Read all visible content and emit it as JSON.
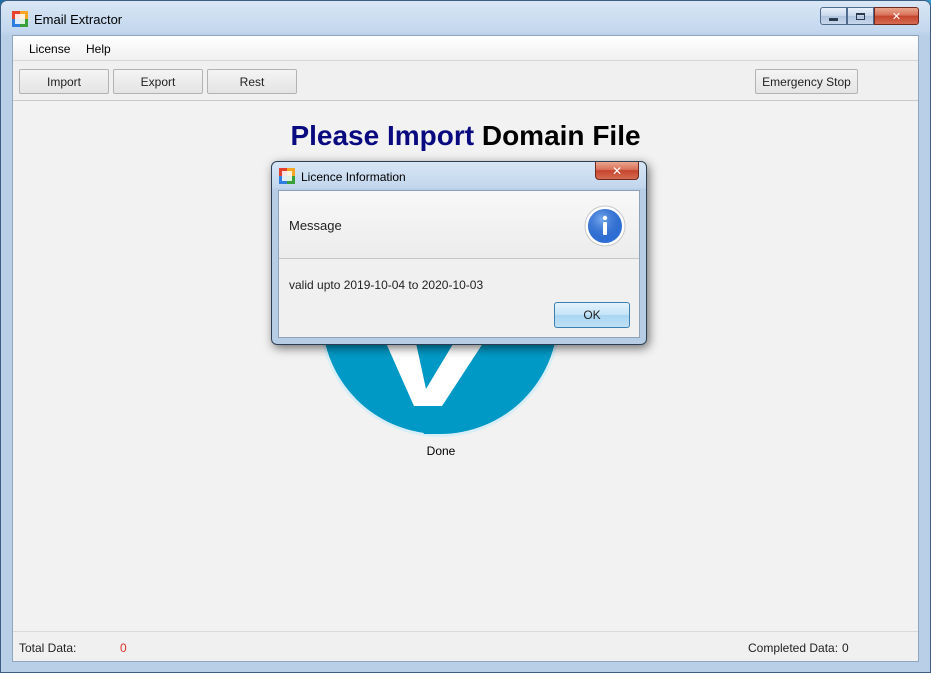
{
  "window": {
    "title": "Email Extractor",
    "controls": {
      "minimize": "",
      "maximize": "",
      "close": "✕"
    }
  },
  "menu": {
    "items": [
      "License",
      "Help"
    ]
  },
  "toolbar": {
    "import_label": "Import",
    "export_label": "Export",
    "rest_label": "Rest",
    "emergency_stop_label": "Emergency Stop"
  },
  "main": {
    "headline_part1": "Please Import",
    "headline_part2": "Domain File",
    "status_label": "Done",
    "status_color": "#0099c6"
  },
  "statusbar": {
    "total_label": "Total Data:",
    "total_value": "0",
    "completed_label": "Completed Data:",
    "completed_value": "0"
  },
  "dialog": {
    "title": "Licence Information",
    "close_label": "✕",
    "header": "Message",
    "icon": "info-icon",
    "message": "valid upto 2019-10-04 to 2020-10-03",
    "ok_label": "OK"
  },
  "colors": {
    "headline_accent": "#0a0a80",
    "circle": "#0099c6",
    "total_value": "#e0312b"
  }
}
